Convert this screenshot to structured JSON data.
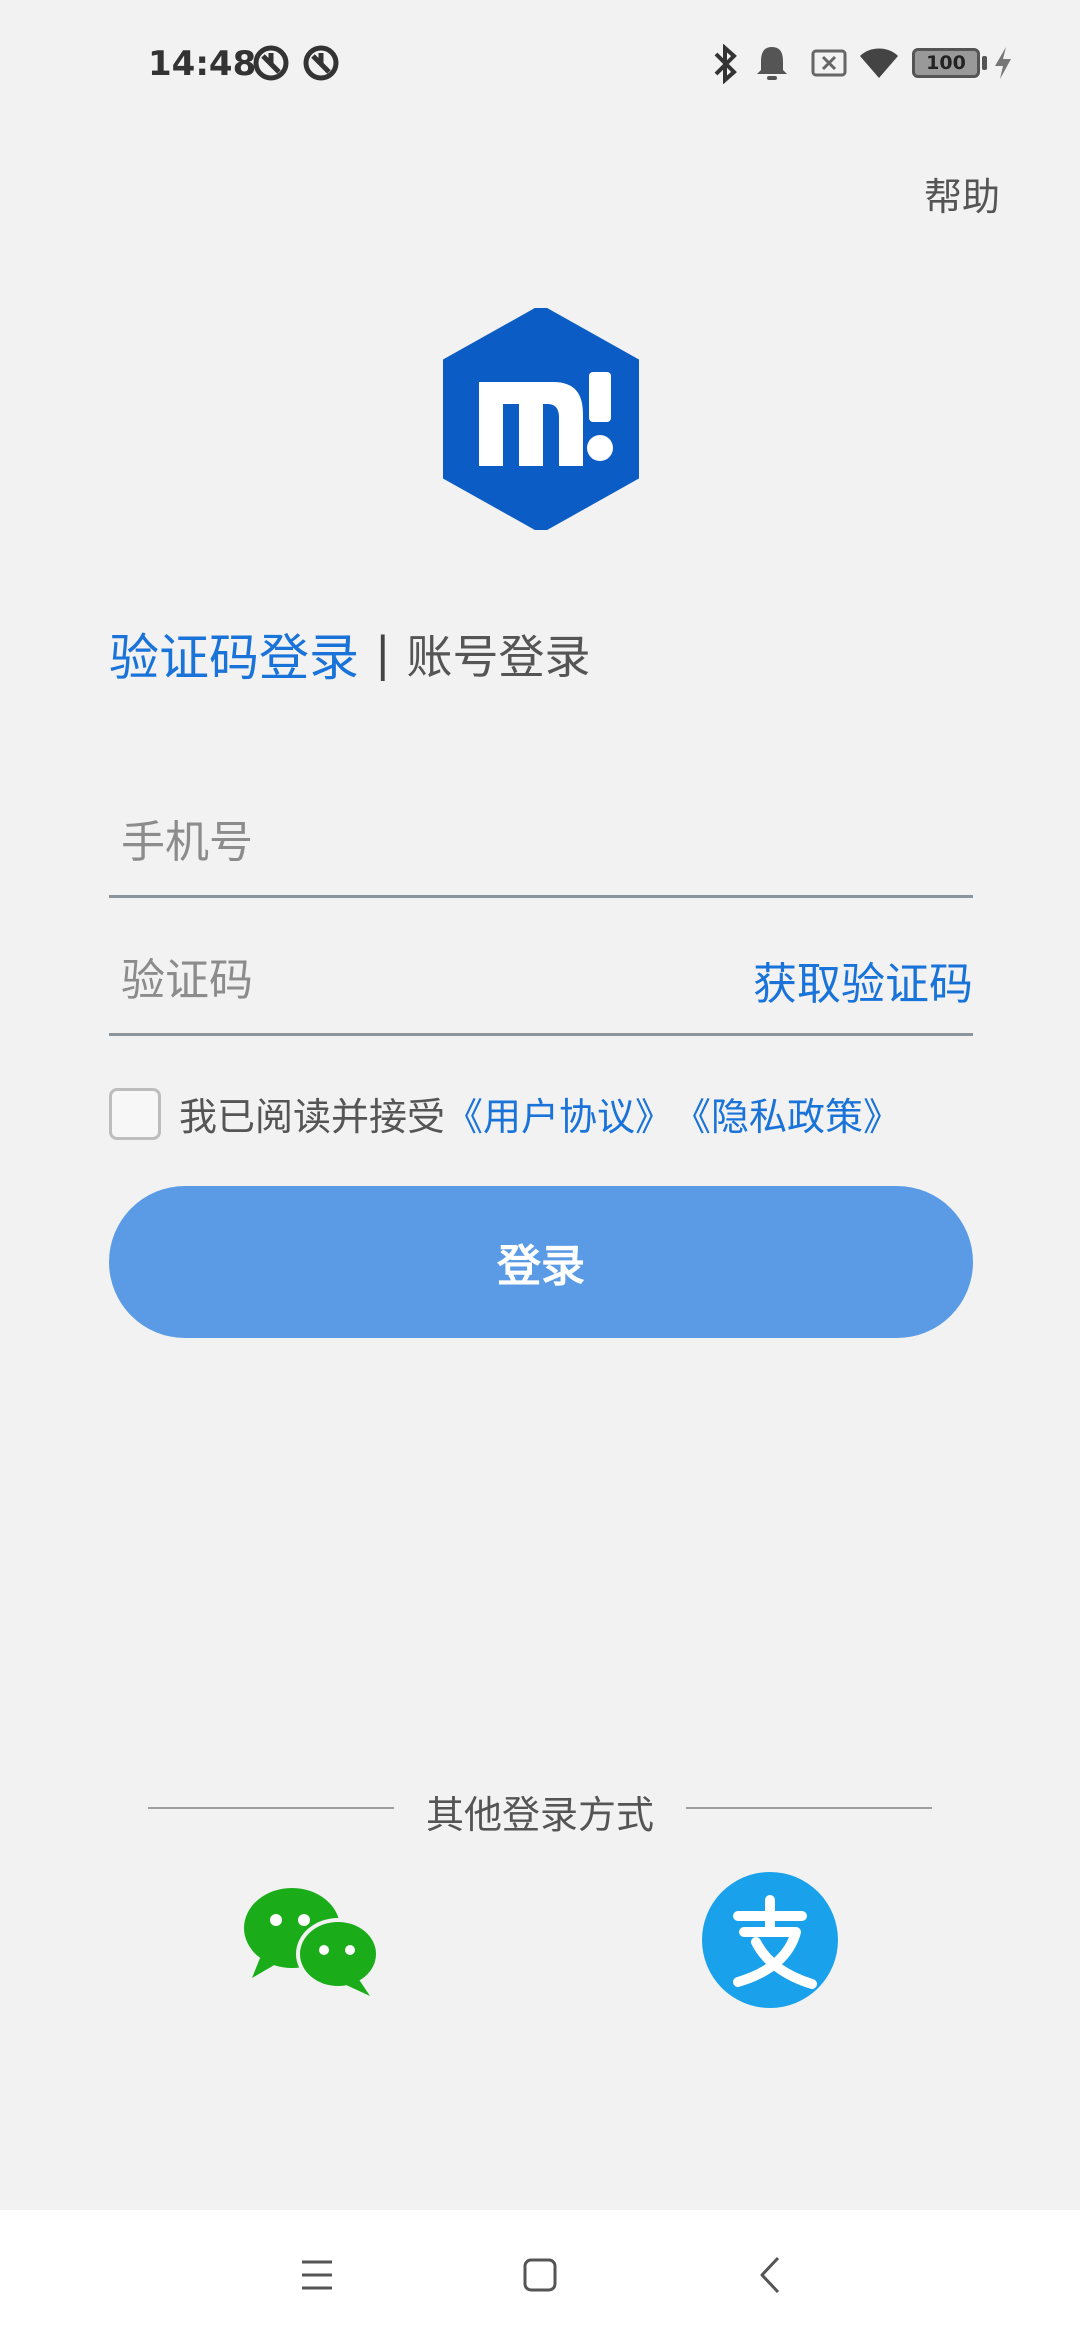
{
  "status_bar": {
    "time": "14:48",
    "battery": "100",
    "icons": [
      "app-notification-icon",
      "app-notification-icon",
      "bluetooth-icon",
      "bell-icon",
      "sim-off-icon",
      "wifi-icon",
      "battery-icon",
      "charging-icon"
    ]
  },
  "header": {
    "help_label": "帮助"
  },
  "login_tabs": {
    "active": "验证码登录",
    "separator": "|",
    "inactive": "账号登录"
  },
  "form": {
    "phone_placeholder": "手机号",
    "code_placeholder": "验证码",
    "get_code_label": "获取验证码"
  },
  "agreement": {
    "text": "我已阅读并接受",
    "user_agreement": "《用户协议》",
    "privacy_policy": "《隐私政策》",
    "checked": false
  },
  "login_button": {
    "label": "登录"
  },
  "other_login": {
    "title": "其他登录方式",
    "methods": [
      "wechat-icon",
      "alipay-icon"
    ]
  },
  "colors": {
    "accent": "#1a73d9",
    "button": "#5b9be6",
    "logo": "#0b5cc4",
    "wechat": "#1aad19",
    "alipay": "#1aa1ec",
    "background": "#f2f2f2"
  },
  "nav_bar": {
    "icons": [
      "menu-icon",
      "home-icon",
      "back-icon"
    ]
  }
}
